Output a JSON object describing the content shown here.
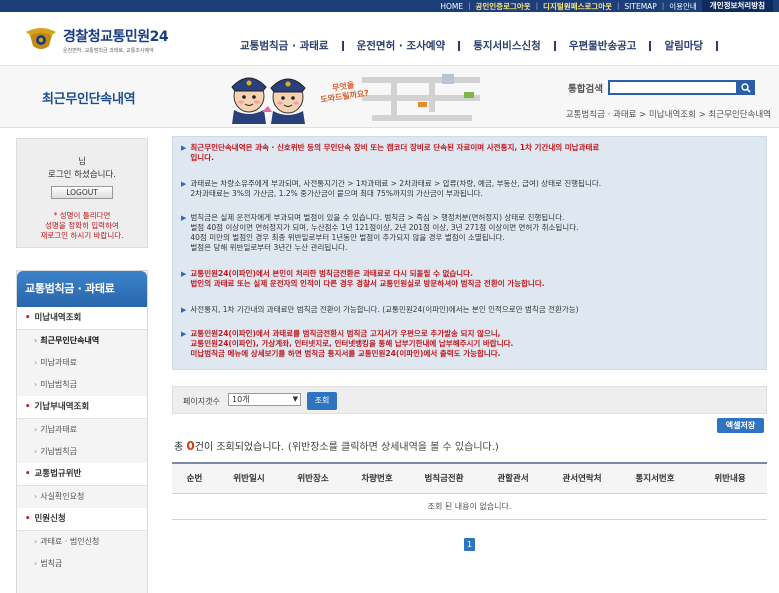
{
  "topbar": {
    "links": [
      {
        "label": "HOME",
        "style": "normal"
      },
      {
        "label": "공인인증로그아웃",
        "style": "hl"
      },
      {
        "label": "디지털원패스로그아웃",
        "style": "hl"
      },
      {
        "label": "SITEMAP",
        "style": "normal"
      },
      {
        "label": "이용안내",
        "style": "normal"
      },
      {
        "label": "개인정보처리방침",
        "style": "dark"
      }
    ]
  },
  "header": {
    "logo_main": "경찰청",
    "logo_brand": "교통민원24",
    "logo_sub": "운전면허, 교통범칙금 과태료, 교통조사예약",
    "nav": [
      "교통범칙금 · 과태료",
      "운전면허 · 조사예약",
      "통지서비스신청",
      "우편물반송공고",
      "알림마당"
    ]
  },
  "subvisual": {
    "page_title": "최근무인단속내역",
    "bubble_text": "무엇을\n도와드릴까요?",
    "search_label": "통합검색",
    "breadcrumb": "교통범칙금 · 과태료 > 미납내역조회 > 최근무인단속내역"
  },
  "login": {
    "line1": "님",
    "line2": "로그인 하셨습니다.",
    "logout_label": "LOGOUT",
    "warn_lines": [
      "* 성명이 틀리다면",
      "성명을 정확히 입력하여",
      "재로그인 하시기 바랍니다."
    ]
  },
  "lnb": {
    "title": "교통범칙금 · 과태료",
    "groups": [
      {
        "label": "미납내역조회",
        "items": [
          {
            "label": "최근무인단속내역",
            "active": true
          },
          {
            "label": "미납과태료"
          },
          {
            "label": "미납범칙금"
          }
        ]
      },
      {
        "label": "기납부내역조회",
        "items": [
          {
            "label": "기납과태료"
          },
          {
            "label": "기납범칙금"
          }
        ]
      },
      {
        "label": "교통법규위반",
        "items": [
          {
            "label": "사실확인요청"
          }
        ]
      },
      {
        "label": "민원신청",
        "items": [
          {
            "label": "과태료 · 범인신청"
          },
          {
            "label": "범칙금"
          }
        ]
      }
    ]
  },
  "notice": [
    {
      "red": true,
      "lines": [
        "최근무인단속내역은 과속 · 신호위반 등의 무인단속 장비 또는 캠코더 장비로 단속된 자료이며 사전통지, 1차 기간내의 미납과태료",
        "입니다."
      ]
    },
    {
      "red": false,
      "lines": [
        "과태료는 차량소유주에게 부과되며, 사전통지기간 > 1차과태료 > 2차과태료 > 압류(차량, 예금, 부동산, 급여) 상태로 진행됩니다.",
        "2차과태료는 3%의 가산금, 1.2% 중가산금이 붙으며 최대 75%까지의 가산금이 부과됩니다."
      ]
    },
    {
      "red": false,
      "lines": [
        "범칙금은 실제 운전자에게 부과되며 벌점이 있을 수 있습니다. 범칙금 > 즉심 > 행정처분(면허정지) 상태로 진행됩니다.",
        "벌점 40점 이상이면 면허정지가 되며, 누산점수 1년 121점이상, 2년 201점 이상, 3년 271점 이상이면 면허가 취소됩니다.",
        "40점 미만의 벌점인 경우 최종 위반일로부터 1년동안 벌점이 추가되지 않을 경우 벌점이 소멸됩니다.",
        "벌점은 당해 위반일로부터 3년간 누산 관리됩니다."
      ]
    },
    {
      "red": true,
      "lines": [
        "교통민원24(이파인)에서 본인이 처리한 범칙금전환은 과태료로 다시 되돌릴 수 없습니다.",
        "법인의 과태료 또는 실제 운전자의 인적이 다른 경우 경찰서 교통민원실로 방문하셔야 범칙금 전환이 가능합니다."
      ]
    },
    {
      "red": false,
      "lines": [
        "사전통지, 1차 기간내의 과태료만 범칙금 전환이 가능합니다. (교통민원24(이파인)에서는 본인 인적으로만 범칙금 전환가능)"
      ]
    },
    {
      "red": true,
      "lines": [
        "교통민원24(이파인)에서 과태료를 범칙금전환시 범칙금 고지서가 우편으로 추가발송 되지 않으니,",
        "교통민원24(이파인), 가상계좌, 인터넷지로, 인터넷뱅킹을 통해 납부기한내에 납부해주시기 바랍니다.",
        "미납범칙금 메뉴에 상세보기를 하면 범칙금 통지서를 교통민원24(이파인)에서 출력도 가능합니다."
      ]
    }
  ],
  "controls": {
    "page_size_label": "페이지갯수",
    "page_size_value": "10개",
    "search_button": "조회",
    "excel_button": "엑셀저장"
  },
  "result": {
    "prefix": "총",
    "count": "0",
    "suffix": "건이 조회되었습니다.",
    "hint": "(위반장소를 클릭하면 상세내역을 볼 수 있습니다.)"
  },
  "table": {
    "columns": [
      "순번",
      "위반일시",
      "위반장소",
      "차량번호",
      "범칙금전환",
      "관할관서",
      "관서연락처",
      "통지서번호",
      "위반내용"
    ],
    "empty_message": "조회 된 내용이 없습니다."
  },
  "pagination": {
    "current": "1"
  },
  "colors": {
    "primary": "#2f74c0",
    "navy": "#1c3f7a",
    "warning": "#c2171c",
    "notice_bg": "#dfe8f1"
  },
  "icons": {
    "search": "magnifier-icon",
    "emblem": "police-emblem-icon"
  }
}
